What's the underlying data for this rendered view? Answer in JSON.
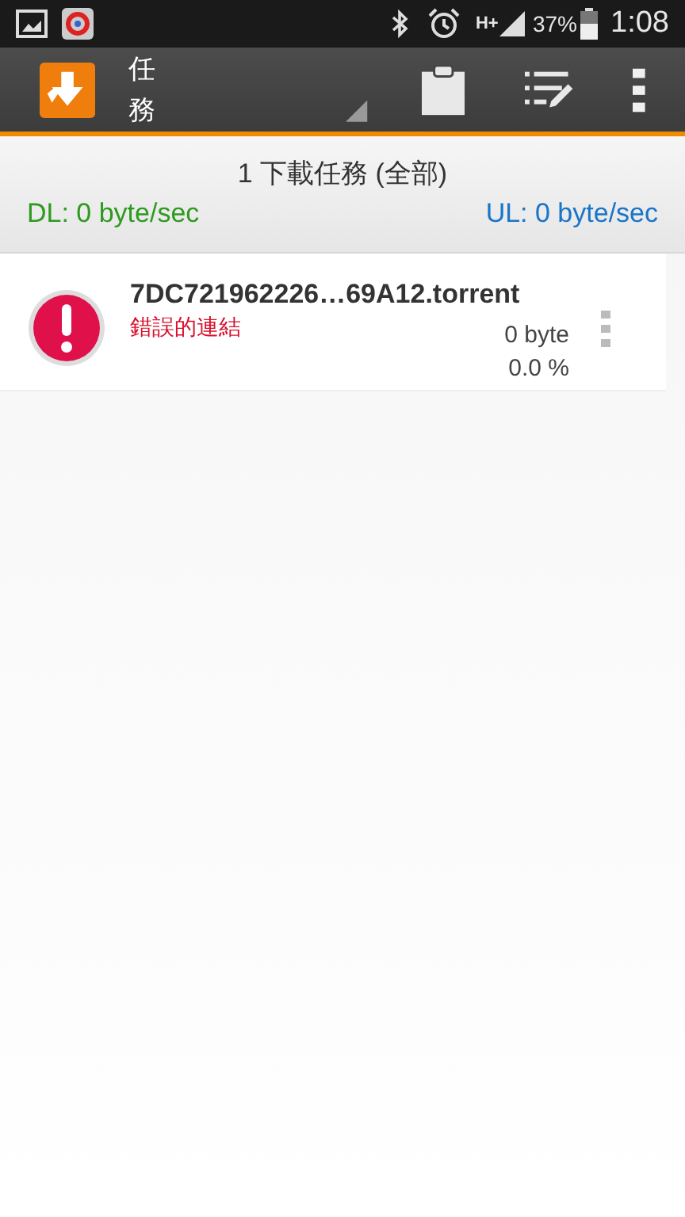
{
  "status_bar": {
    "battery": "37%",
    "time": "1:08",
    "network": "H+"
  },
  "app_bar": {
    "title": "任務"
  },
  "summary": {
    "title": "1 下載任務 (全部)",
    "download": "DL: 0 byte/sec",
    "upload": "UL: 0 byte/sec"
  },
  "tasks": [
    {
      "kind": "error",
      "name": "7DC721962226…69A12.torrent",
      "status": "錯誤的連結",
      "size": "0 byte",
      "progress": "0.0 %"
    }
  ]
}
